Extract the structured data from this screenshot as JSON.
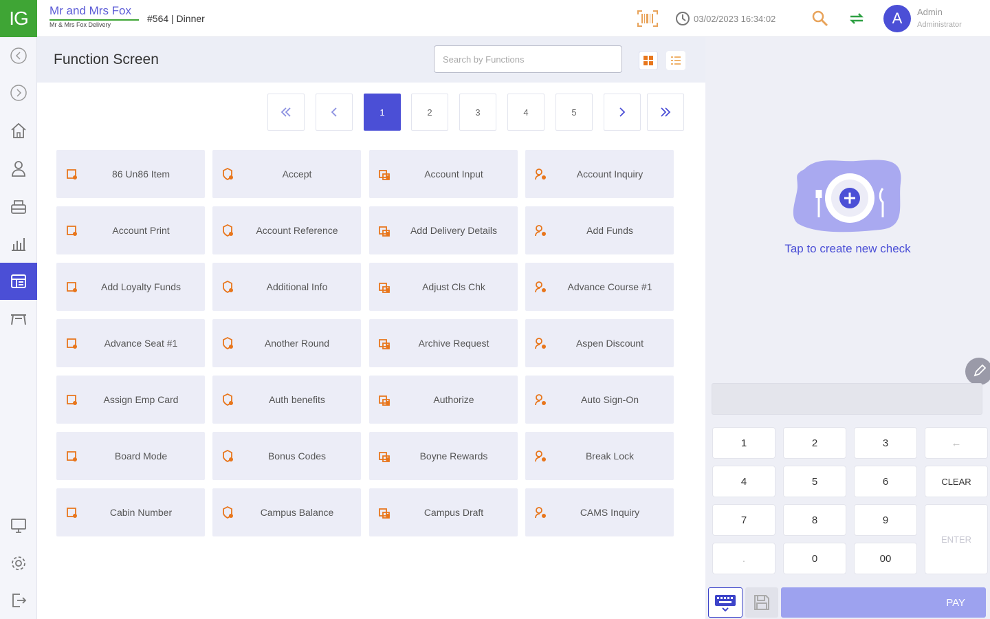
{
  "header": {
    "logo": "IG",
    "restaurant_name": "Mr and Mrs Fox",
    "restaurant_sub": "Mr & Mrs Fox Delivery",
    "order": "#564 | Dinner",
    "datetime": "03/02/2023 16:34:02",
    "avatar_letter": "A",
    "user_name": "Admin",
    "user_role": "Administrator"
  },
  "sidebar": {
    "items": [
      {
        "icon": "back-circle-icon"
      },
      {
        "icon": "forward-circle-icon"
      },
      {
        "icon": "home-icon"
      },
      {
        "icon": "user-icon"
      },
      {
        "icon": "cash-register-icon"
      },
      {
        "icon": "reports-chart-icon"
      },
      {
        "icon": "function-screen-icon",
        "active": true
      },
      {
        "icon": "table-icon"
      },
      {
        "icon": "monitor-icon"
      },
      {
        "icon": "settings-gear-icon"
      },
      {
        "icon": "logout-icon"
      }
    ]
  },
  "main": {
    "title": "Function Screen",
    "search_placeholder": "Search by Functions",
    "pager": {
      "pages": [
        "1",
        "2",
        "3",
        "4",
        "5"
      ],
      "current_page": 1
    },
    "functions": [
      "86 Un86 Item",
      "Accept",
      "Account Input",
      "Account Inquiry",
      "Account Print",
      "Account Reference",
      "Add Delivery Details",
      "Add Funds",
      "Add Loyalty Funds",
      "Additional Info",
      "Adjust Cls Chk",
      "Advance Course #1",
      "Advance Seat #1",
      "Another Round",
      "Archive Request",
      "Aspen Discount",
      "Assign Emp Card",
      "Auth benefits",
      "Authorize",
      "Auto Sign-On",
      "Board Mode",
      "Bonus Codes",
      "Boyne Rewards",
      "Break Lock",
      "Cabin Number",
      "Campus Balance",
      "Campus Draft",
      "CAMS Inquiry"
    ]
  },
  "check_panel": {
    "new_check_label": "Tap to create new check",
    "keypad": [
      "1",
      "2",
      "3",
      "←",
      "4",
      "5",
      "6",
      "CLEAR",
      "7",
      "8",
      "9",
      "ENTER",
      ".",
      "0",
      "00"
    ],
    "pay_label": "PAY"
  },
  "colors": {
    "brand_green": "#3fa535",
    "accent_blue": "#4b4fd6",
    "icon_orange": "#e8761c",
    "pay_button": "#9da2ef"
  }
}
